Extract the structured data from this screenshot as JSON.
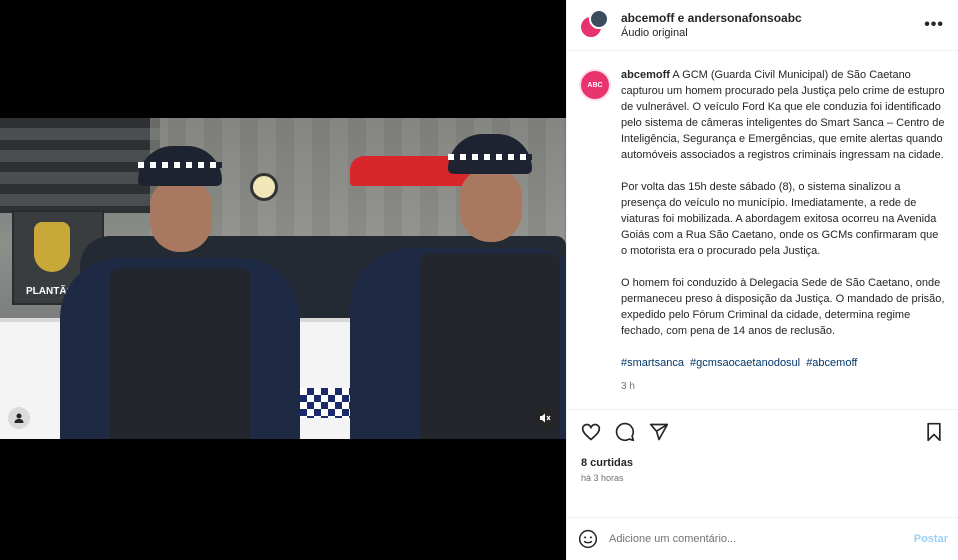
{
  "header": {
    "title": "abcemoff e andersonafonsoabc",
    "subtitle": "Áudio original",
    "more_icon": "more-horizontal-icon"
  },
  "video": {
    "sign_text": "PLANTÃO",
    "avatar_icon": "user-tag-icon",
    "mute_icon": "speaker-muted-icon"
  },
  "caption": {
    "username": "abcemoff",
    "avatar_label": "ABC",
    "paragraphs": [
      "A GCM (Guarda Civil Municipal) de São Caetano capturou um homem procurado pela Justiça pelo crime de estupro de vulnerável. O veículo Ford Ka que ele conduzia foi identificado pelo sistema de câmeras inteligentes do Smart Sanca – Centro de Inteligência, Segurança e Emergências, que emite alertas quando automóveis associados a registros criminais ingressam na cidade.",
      "Por volta das 15h deste sábado (8), o sistema sinalizou a presença do veículo no município. Imediatamente, a rede de viaturas foi mobilizada. A abordagem exitosa ocorreu na Avenida Goiás com a Rua São Caetano, onde os GCMs confirmaram que o motorista era o procurado pela Justiça.",
      "O homem foi conduzido à Delegacia Sede de São Caetano, onde permaneceu preso à disposição da Justiça. O mandado de prisão, expedido pelo Fórum Criminal da cidade, determina regime fechado, com pena de 14 anos de reclusão."
    ],
    "hashtags": [
      "#smartsanca",
      "#gcmsaocaetanodosul",
      "#abcemoff"
    ],
    "time": "3 h"
  },
  "actions": {
    "like_icon": "heart-icon",
    "comment_icon": "comment-icon",
    "share_icon": "send-icon",
    "save_icon": "bookmark-icon"
  },
  "likes": {
    "count": "8 curtidas",
    "ago": "há 3 horas"
  },
  "add_comment": {
    "emoji_icon": "emoji-icon",
    "placeholder": "Adicione um comentário...",
    "post_label": "Postar"
  },
  "colors": {
    "brand": "#e8336e",
    "link": "#00376b",
    "post_disabled": "#9ccff6"
  }
}
